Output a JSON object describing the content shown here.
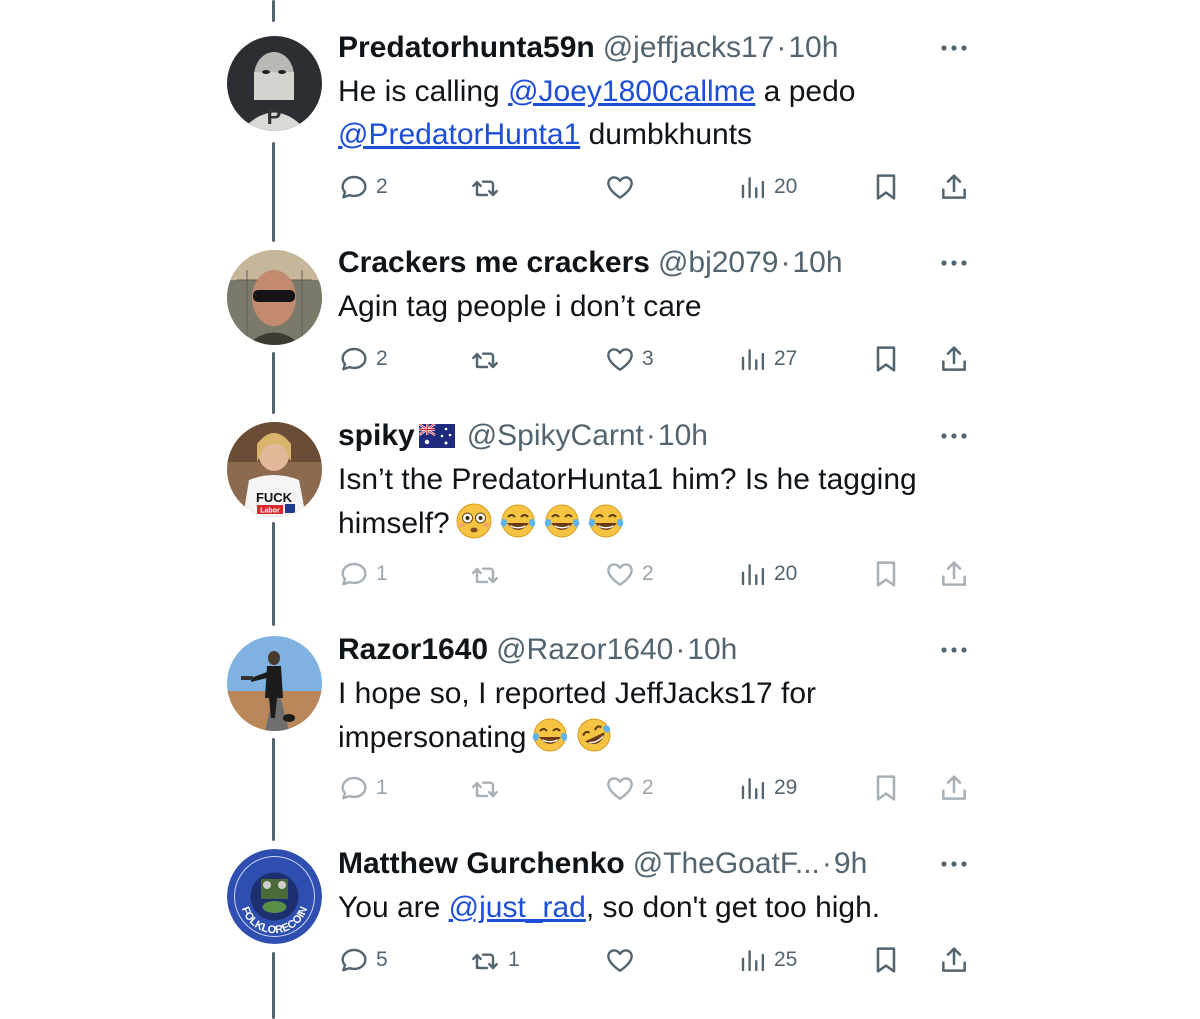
{
  "tweets": [
    {
      "name": "Predatorhunta59n",
      "handle": "@jeffjacks17",
      "dot": "·",
      "time": "10h",
      "text_parts": [
        "He is calling ",
        "@Joey1800callme",
        " a pedo ",
        "@PredatorHunta1",
        " dumbkhunts"
      ],
      "counts": {
        "reply": "2",
        "repost": "",
        "like": "",
        "views": "20"
      },
      "avatar_icon": "masked-figure-avatar"
    },
    {
      "name": "Crackers me crackers",
      "handle": "@bj2079",
      "dot": "·",
      "time": "10h",
      "text": "Agin tag people i don’t care",
      "counts": {
        "reply": "2",
        "repost": "",
        "like": "3",
        "views": "27"
      },
      "avatar_icon": "bald-man-sunglasses-avatar"
    },
    {
      "name": "spiky",
      "flag": "australian-flag-icon",
      "handle": "@SpikyCarnt",
      "dot": "·",
      "time": "10h",
      "text_parts": [
        "Isn’t the PredatorHunta1 him? Is he tagging himself?"
      ],
      "emojis": [
        "flushed-face-emoji",
        "tears-of-joy-emoji",
        "tears-of-joy-emoji",
        "tears-of-joy-emoji"
      ],
      "shirt_text": "FUCK",
      "shirt_badge": "Labor",
      "counts": {
        "reply": "1",
        "repost": "",
        "like": "2",
        "views": "20"
      },
      "avatar_icon": "woman-tshirt-avatar"
    },
    {
      "name": "Razor1640",
      "handle": "@Razor1640",
      "dot": "·",
      "time": "10h",
      "text_parts": [
        "I hope so, I reported JeffJacks17 for impersonating"
      ],
      "emojis": [
        "tears-of-joy-emoji",
        "rolling-on-floor-laughing-emoji"
      ],
      "counts": {
        "reply": "1",
        "repost": "",
        "like": "2",
        "views": "29"
      },
      "avatar_icon": "road-warrior-avatar"
    },
    {
      "name": "Matthew Gurchenko",
      "handle": "@TheGoatF...",
      "dot": "·",
      "time": "9h",
      "text_parts": [
        "You are ",
        "@just_rad",
        ", so don't get too high."
      ],
      "badge_text": "FOLKLORECOIN",
      "counts": {
        "reply": "5",
        "repost": "1",
        "like": "",
        "views": "25"
      },
      "avatar_icon": "folklorecoin-logo-avatar"
    }
  ],
  "colors": {
    "text": "#0f1419",
    "secondary": "#536471",
    "mention": "#1d4ed8",
    "thread_line": "#536471"
  }
}
